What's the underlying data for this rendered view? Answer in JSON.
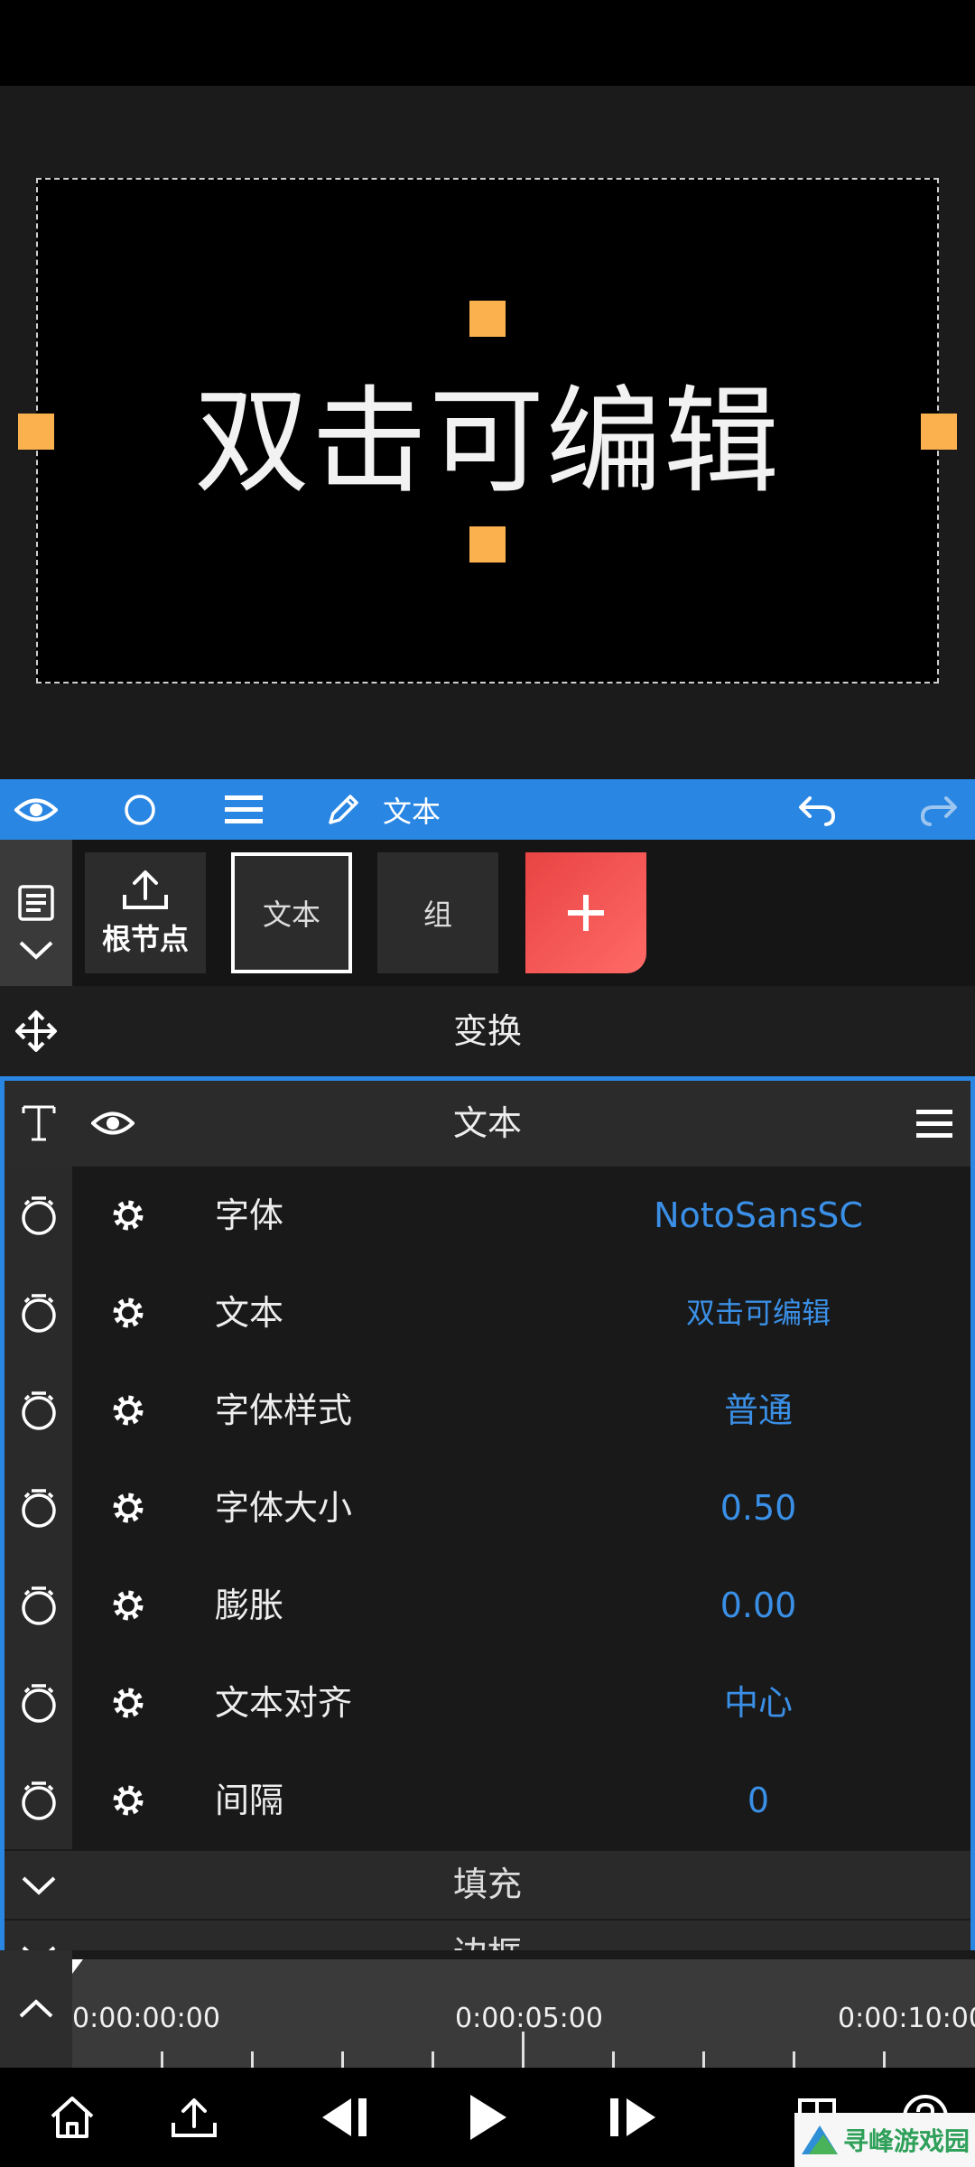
{
  "canvas": {
    "text": "双击可编辑"
  },
  "toolbar": {
    "label": "文本"
  },
  "nodes": {
    "root_label": "根节点",
    "text_label": "文本",
    "group_label": "组"
  },
  "transform": {
    "label": "变换"
  },
  "panel": {
    "title": "文本",
    "rows": [
      {
        "label": "字体",
        "value": "NotoSansSC"
      },
      {
        "label": "文本",
        "value": "双击可编辑"
      },
      {
        "label": "字体样式",
        "value": "普通"
      },
      {
        "label": "字体大小",
        "value": "0.50"
      },
      {
        "label": "膨胀",
        "value": "0.00"
      },
      {
        "label": "文本对齐",
        "value": "中心"
      },
      {
        "label": "间隔",
        "value": "0"
      }
    ],
    "sections": [
      {
        "label": "填充"
      },
      {
        "label": "边框"
      }
    ]
  },
  "timeline": {
    "times": [
      "0:00:00:00",
      "0:00:05:00",
      "0:00:10:00"
    ]
  },
  "watermark": {
    "text": "寻峰游戏园"
  },
  "colors": {
    "accent": "#2a86e3",
    "handle": "#fbb24e",
    "add": "#f05553",
    "value": "#3a8fe6"
  },
  "icons": [
    "eye-icon",
    "circle-icon",
    "menu-icon",
    "pencil-icon",
    "undo-icon",
    "redo-icon",
    "layers-icon",
    "chevron-down-icon",
    "upload-icon",
    "plus-icon",
    "move-icon",
    "text-icon",
    "stopwatch-icon",
    "gear-icon",
    "chevron-up-icon",
    "home-icon",
    "share-icon",
    "step-back-icon",
    "play-icon",
    "step-forward-icon",
    "grid-icon",
    "help-icon"
  ]
}
